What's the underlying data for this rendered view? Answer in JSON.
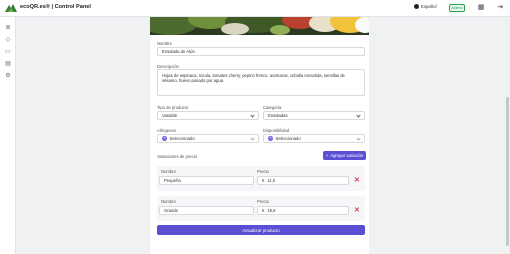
{
  "app": {
    "title": "ecoQR.es® | Control Panel",
    "language": "Español",
    "status": "Abierto"
  },
  "sidebar": {
    "icons": [
      "list-icon",
      "tag-icon",
      "inbox-icon",
      "qr-icon",
      "gear-icon"
    ]
  },
  "form": {
    "name_label": "Nombre",
    "name_value": "Ensalada de Atún",
    "description_label": "Descripción",
    "description_value": "Hojas de espinaca, rúcula, tomates cherry, pepino fresco, aceitunas, cebolla encurtida, semillas de sésamo, huevo pasado por agua.",
    "type_label": "Tipo de producto",
    "type_value": "Variable",
    "category_label": "Categoría",
    "category_value": "Ensaladas",
    "allergens_label": "Alérgenos",
    "allergens_value": "Seleccionado",
    "availability_label": "Disponibilidad",
    "availability_value": "Seleccionado",
    "variations_label": "Variaciones de precio",
    "add_variation": "Agregar variación",
    "variant_name_label": "Nombre",
    "variant_price_label": "Precio",
    "currency": "€",
    "variants": [
      {
        "name": "Pequeña",
        "price": "11,0"
      },
      {
        "name": "Grande",
        "price": "19,8"
      }
    ],
    "update_button": "Actualizar producto"
  }
}
